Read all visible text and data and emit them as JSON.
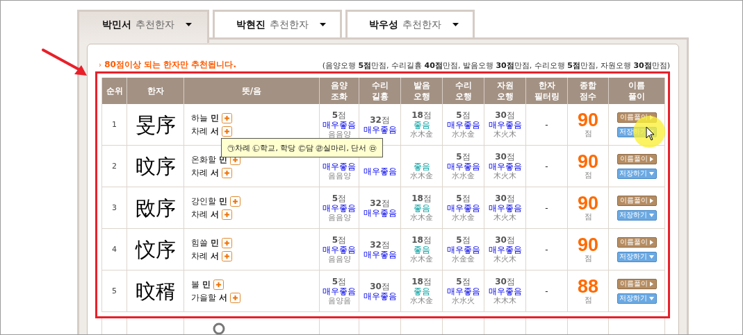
{
  "tabs": [
    {
      "name": "박민서",
      "suffix": "추천한자",
      "selected": true
    },
    {
      "name": "박현진",
      "suffix": "추천한자",
      "selected": false
    },
    {
      "name": "박우성",
      "suffix": "추천한자",
      "selected": false
    }
  ],
  "notice": "80점이상 되는 한자만 추천됩니다.",
  "notice_bullet": "›",
  "score_note": "(음양오행 **5점**만점, 수리길흉 **40점**만점, 발음오행 **30점**만점, 수리오행 **5점**만점, 자원오행 **30점**만점)",
  "columns": [
    "순위",
    "한자",
    "뜻/음",
    "음양 조화",
    "수리 길흉",
    "발음 오행",
    "수리 오행",
    "자원 오행",
    "한자 필터링",
    "종합 점수",
    "이름 풀이"
  ],
  "rows": [
    {
      "rank": "1",
      "hanja": "旻序",
      "meanings": [
        "하늘 **민**",
        "차례 **서**"
      ],
      "scores": [
        {
          "score": "**5**점",
          "status": "매우좋음",
          "color": "#0000ee",
          "elements": "음음양"
        },
        {
          "score": "**32**점",
          "status": "매우좋음",
          "color": "#0000ee"
        },
        {
          "score": "**18**점",
          "status": "좋음",
          "color": "#00a0a0",
          "elements": "水木金"
        },
        {
          "score": "**5**점",
          "status": "매우좋음",
          "color": "#0000ee",
          "elements": "水水金"
        },
        {
          "score": "**30**점",
          "status": "매우좋음",
          "color": "#0000ee",
          "elements": "木火木"
        }
      ],
      "filter": "-",
      "total": "90",
      "unit": "점",
      "buttons": [
        {
          "kind": "interpret",
          "label": "이름풀이"
        },
        {
          "kind": "save",
          "label": "저장하기"
        }
      ]
    },
    {
      "rank": "2",
      "hanja": "旼序",
      "meanings": [
        "온화할 **민**",
        "차례 **서**"
      ],
      "scores": [
        {
          "status": "매우좋음",
          "color": "#0000ee",
          "elements": "음음양"
        },
        {
          "status": "매우좋음",
          "color": "#0000ee"
        },
        {
          "status": "좋음",
          "color": "#00a0a0",
          "elements": "水木金"
        },
        {
          "score": "**5**점",
          "status": "매우좋음",
          "color": "#0000ee",
          "elements": "水水金"
        },
        {
          "score": "**30**점",
          "status": "매우좋음",
          "color": "#0000ee",
          "elements": "木火木"
        }
      ],
      "filter": "-",
      "total": "90",
      "unit": "점",
      "buttons": [
        {
          "kind": "interpret",
          "label": "이름풀이"
        },
        {
          "kind": "save",
          "label": "저장하기"
        }
      ]
    },
    {
      "rank": "3",
      "hanja": "敃序",
      "meanings": [
        "강인할 **민**",
        "차례 **서**"
      ],
      "scores": [
        {
          "score": "**5**점",
          "status": "매우좋음",
          "color": "#0000ee",
          "elements": "음음양"
        },
        {
          "score": "**32**점",
          "status": "매우좋음",
          "color": "#0000ee"
        },
        {
          "score": "**18**점",
          "status": "좋음",
          "color": "#00a0a0",
          "elements": "水木金"
        },
        {
          "score": "**5**점",
          "status": "매우좋음",
          "color": "#0000ee",
          "elements": "水水金"
        },
        {
          "score": "**30**점",
          "status": "매우좋음",
          "color": "#0000ee",
          "elements": "木火木"
        }
      ],
      "filter": "-",
      "total": "90",
      "unit": "점",
      "buttons": [
        {
          "kind": "interpret",
          "label": "이름풀이"
        },
        {
          "kind": "save",
          "label": "저장하기"
        }
      ]
    },
    {
      "rank": "4",
      "hanja": "忟序",
      "meanings": [
        "힘쓸 **민**",
        "차례 **서**"
      ],
      "scores": [
        {
          "score": "**5**점",
          "status": "매우좋음",
          "color": "#0000ee",
          "elements": "음음양"
        },
        {
          "score": "**32**점",
          "status": "매우좋음",
          "color": "#0000ee"
        },
        {
          "score": "**18**점",
          "status": "좋음",
          "color": "#00a0a0",
          "elements": "水木金"
        },
        {
          "score": "**5**점",
          "status": "매우좋음",
          "color": "#0000ee",
          "elements": "水金金"
        },
        {
          "score": "**30**점",
          "status": "매우좋음",
          "color": "#0000ee",
          "elements": "木火木"
        }
      ],
      "filter": "-",
      "total": "90",
      "unit": "점",
      "buttons": [
        {
          "kind": "interpret",
          "label": "이름풀이"
        },
        {
          "kind": "save",
          "label": "저장하기"
        }
      ]
    },
    {
      "rank": "5",
      "hanja": "旼稰",
      "meanings": [
        "볼 **민**",
        "가을할 **서**"
      ],
      "scores": [
        {
          "score": "**5**점",
          "status": "매우좋음",
          "color": "#0000ee",
          "elements": "음양음"
        },
        {
          "score": "**30**점",
          "status": "매우좋음",
          "color": "#0000ee"
        },
        {
          "score": "**18**점",
          "status": "좋음",
          "color": "#00a0a0",
          "elements": "水木金"
        },
        {
          "score": "**5**점",
          "status": "매우좋음",
          "color": "#0000ee",
          "elements": "水水火"
        },
        {
          "score": "**30**점",
          "status": "매우좋음",
          "color": "#0000ee",
          "elements": "木木木"
        }
      ],
      "filter": "-",
      "total": "88",
      "unit": "점",
      "buttons": [
        {
          "kind": "interpret",
          "label": "이름풀이"
        },
        {
          "kind": "save",
          "label": "저장하기"
        }
      ]
    }
  ],
  "tooltip": "㉠차례 ㉡학교, 학당 ㉢담 ㉣실마리, 단서 ㉤"
}
